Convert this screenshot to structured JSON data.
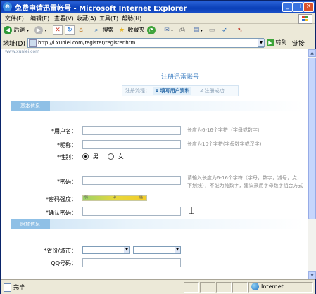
{
  "window": {
    "title": "免费申请迅雷帐号 - Microsoft Internet Explorer",
    "buttons": {
      "minimize": "_",
      "maximize": "□",
      "close": "×"
    }
  },
  "menu": [
    "文件(F)",
    "编辑(E)",
    "查看(V)",
    "收藏(A)",
    "工具(T)",
    "帮助(H)"
  ],
  "toolbar": {
    "back": "后退",
    "search": "搜索",
    "favorites": "收藏夹"
  },
  "address": {
    "label": "地址(D)",
    "url": "http://i.xunlei.com/register/register.htm",
    "go": "转到",
    "links": "链接"
  },
  "page": {
    "site_logo": "www.xunlei.com",
    "title": "注册迅雷帐号",
    "steps": {
      "label": "注册流程：",
      "step1": "1 填写用户资料",
      "step2": "2 注册成功"
    },
    "section_basic": "基本信息",
    "section_extra": "附加信息",
    "fields": {
      "username": {
        "label": "*用户名：",
        "hint": "长度为6-16个字符（字母或数字）"
      },
      "nickname": {
        "label": "*昵称：",
        "hint": "长度为10个字符(字母数字或汉字)"
      },
      "gender": {
        "label": "*性别：",
        "male": "男",
        "female": "女"
      },
      "password": {
        "label": "*密码：",
        "hint_line1": "请输入长度为6-16个字符（字母，数字，减号，点，",
        "hint_line2": "下划线），不能为纯数字，建议采用字母数字组合方式"
      },
      "strength": {
        "label": "*密码强度：",
        "weak": "弱",
        "medium": "中",
        "strong": "强"
      },
      "confirm": {
        "label": "*确认密码："
      },
      "province": {
        "label": "*省份/城市："
      },
      "qq": {
        "label": "QQ号码："
      }
    }
  },
  "status": {
    "text": "完毕",
    "zone": "Internet"
  },
  "colors": {
    "title_bar": "#0a3fb8",
    "accent": "#3b7dc2",
    "section_tab": "#8fc0e6",
    "chrome": "#ece9d8"
  }
}
